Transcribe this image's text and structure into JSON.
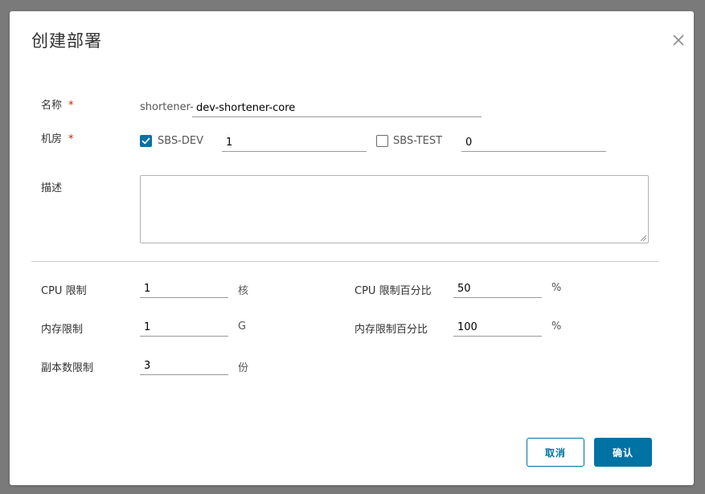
{
  "dialog": {
    "title": "创建部署",
    "close_icon": "close-icon"
  },
  "form": {
    "name": {
      "label": "名称",
      "required_mark": "*",
      "prefix": "shortener-",
      "value": "dev-shortener-core"
    },
    "datacenter": {
      "label": "机房",
      "required_mark": "*",
      "options": [
        {
          "label": "SBS-DEV",
          "checked": true,
          "count": "1"
        },
        {
          "label": "SBS-TEST",
          "checked": false,
          "count": "0"
        }
      ]
    },
    "description": {
      "label": "描述",
      "value": ""
    },
    "cpu_limit": {
      "label": "CPU 限制",
      "value": "1",
      "unit": "核"
    },
    "cpu_limit_percent": {
      "label": "CPU 限制百分比",
      "value": "50",
      "unit": "%"
    },
    "memory_limit": {
      "label": "内存限制",
      "value": "1",
      "unit": "G"
    },
    "memory_limit_percent": {
      "label": "内存限制百分比",
      "value": "100",
      "unit": "%"
    },
    "replica_limit": {
      "label": "副本数限制",
      "value": "3",
      "unit": "份"
    }
  },
  "footer": {
    "cancel_label": "取消",
    "confirm_label": "确认"
  },
  "colors": {
    "accent": "#0072a3",
    "required": "#c92100",
    "backdrop": "#7a7a7a"
  }
}
